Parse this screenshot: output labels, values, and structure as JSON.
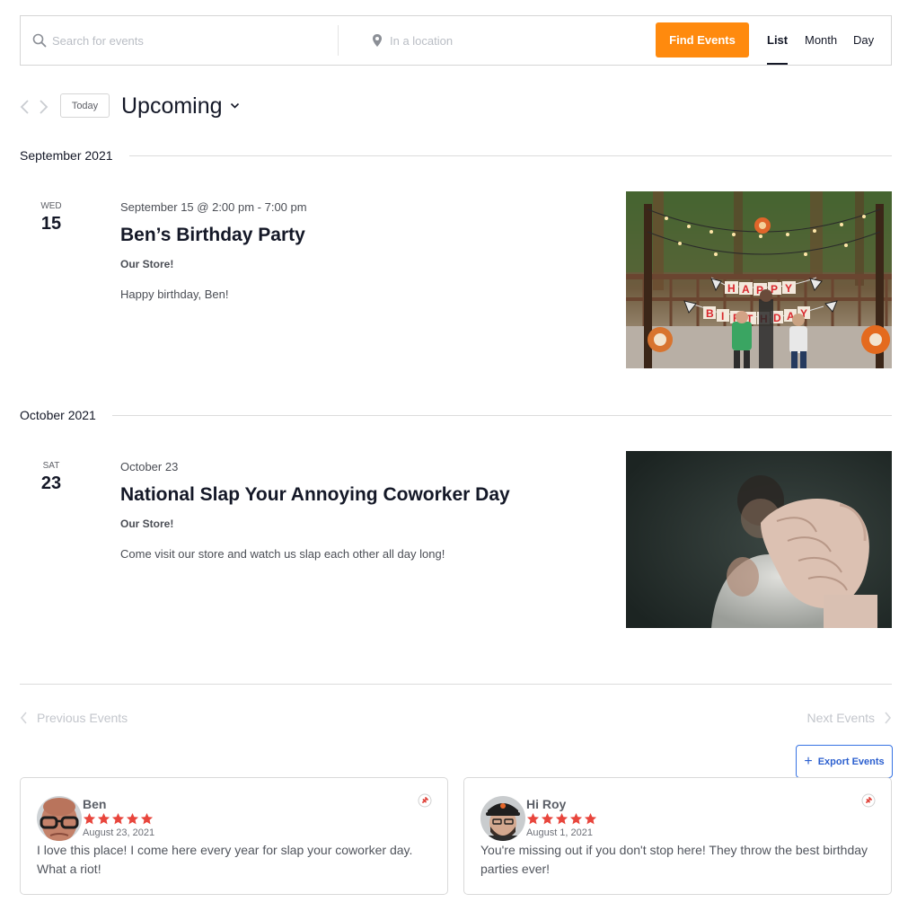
{
  "search": {
    "keyword_placeholder": "Search for events",
    "location_placeholder": "In a location",
    "find_button": "Find Events"
  },
  "views": [
    {
      "label": "List",
      "active": true
    },
    {
      "label": "Month",
      "active": false
    },
    {
      "label": "Day",
      "active": false
    }
  ],
  "nav": {
    "today": "Today",
    "range_label": "Upcoming"
  },
  "months": [
    {
      "label": "September 2021"
    },
    {
      "label": "October 2021"
    }
  ],
  "events": [
    {
      "dow": "WED",
      "day": "15",
      "datetime": "September 15 @ 2:00 pm - 7:00 pm",
      "title": "Ben’s Birthday Party",
      "venue": "Our Store!",
      "description": "Happy birthday, Ben!",
      "banner_letters": [
        "HAPPY",
        "BIRTHDAY"
      ]
    },
    {
      "dow": "SAT",
      "day": "23",
      "datetime": "October 23",
      "title": "National Slap Your Annoying Coworker Day",
      "venue": "Our Store!",
      "description": "Come visit our store and watch us slap each other all day long!"
    }
  ],
  "pagination": {
    "previous": "Previous Events",
    "next": "Next Events"
  },
  "export": {
    "label": "Export Events"
  },
  "reviews": [
    {
      "name": "Ben",
      "rating": 5,
      "date": "August 23, 2021",
      "text": "I love this place! I come here every year for slap your coworker day. What a riot!"
    },
    {
      "name": "Hi Roy",
      "rating": 5,
      "date": "August 1, 2021",
      "text": "You're missing out if you don't stop here! They throw the best birthday parties ever!"
    }
  ],
  "colors": {
    "accent": "#ff8a0e",
    "text_dark": "#141827",
    "star": "#e8453c",
    "export_blue": "#3773e3"
  },
  "icons": {
    "keyword": "search-icon",
    "location": "map-pin-icon",
    "review_source": "pin-icon"
  }
}
